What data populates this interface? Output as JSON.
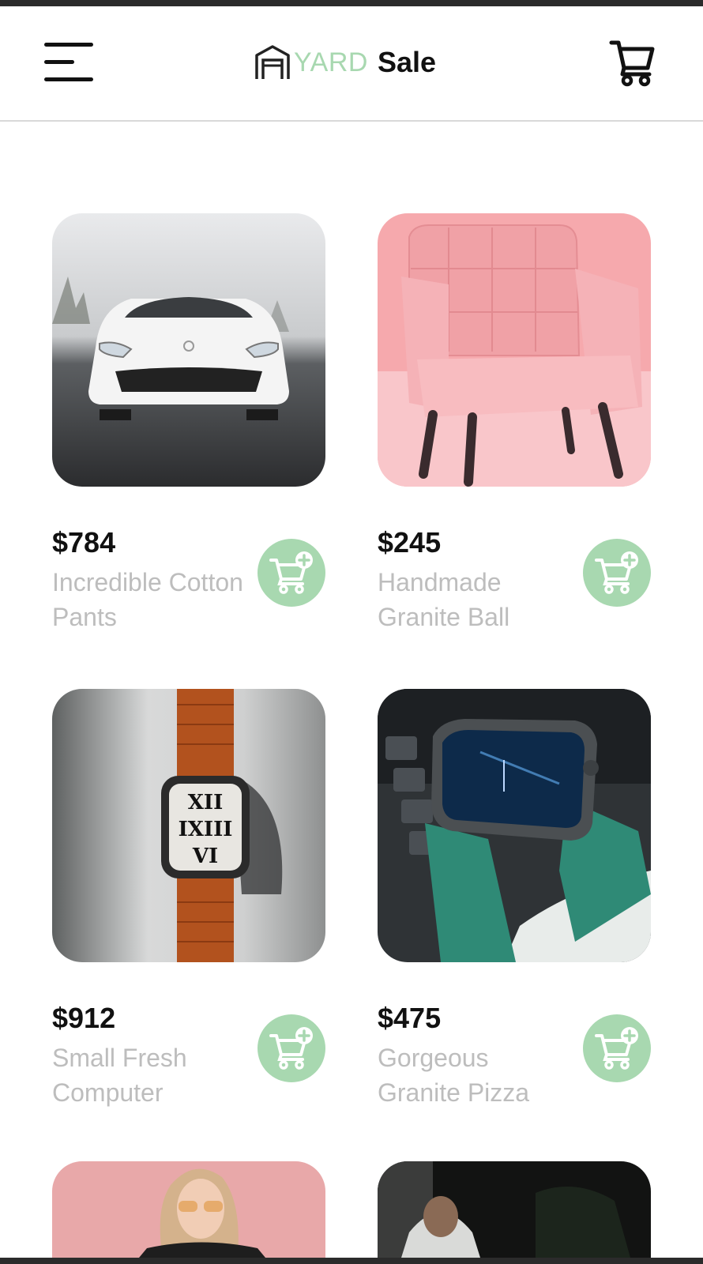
{
  "header": {
    "logo_part1": "YARD",
    "logo_part2": "Sale"
  },
  "colors": {
    "accent": "#a8d8b0",
    "price": "#111111",
    "name": "#bdbdbd"
  },
  "products": [
    {
      "price": "$784",
      "name": "Incredible Cotton Pants",
      "image": "white-sports-car"
    },
    {
      "price": "$245",
      "name": "Handmade Granite Ball",
      "image": "pink-armchair"
    },
    {
      "price": "$912",
      "name": "Small Fresh Computer",
      "image": "smartwatch-orange-band"
    },
    {
      "price": "$475",
      "name": "Gorgeous Granite Pizza",
      "image": "smartwatch-green-band"
    },
    {
      "price": "",
      "name": "",
      "image": "woman-pink-wall"
    },
    {
      "price": "",
      "name": "",
      "image": "woman-dark-background"
    }
  ]
}
